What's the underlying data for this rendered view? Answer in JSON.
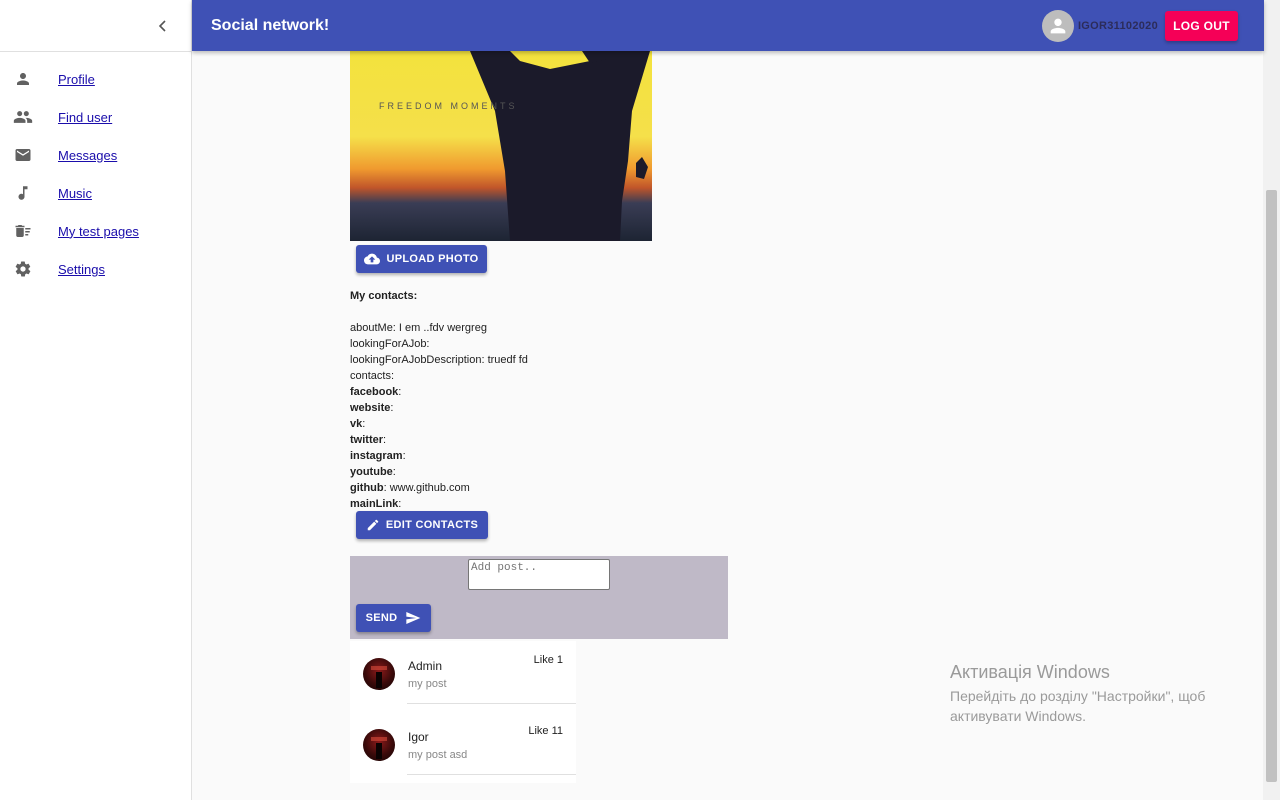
{
  "app": {
    "title": "Social network!"
  },
  "user": {
    "name": "IGOR31102020",
    "logout_label": "LOG OUT"
  },
  "sidebar": {
    "items": [
      {
        "label": "Profile",
        "icon": "person-icon"
      },
      {
        "label": "Find user",
        "icon": "people-icon"
      },
      {
        "label": "Messages",
        "icon": "mail-icon"
      },
      {
        "label": "Music",
        "icon": "music-note-icon"
      },
      {
        "label": "My test pages",
        "icon": "delete-sweep-icon"
      },
      {
        "label": "Settings",
        "icon": "gear-icon"
      }
    ]
  },
  "profile": {
    "photo_caption": "FREEDOM MOMENTS",
    "upload_label": "UPLOAD PHOTO",
    "contacts_title": "My contacts:",
    "about_me": "aboutMe: I em ..fdv wergreg",
    "looking_for_job": "lookingForAJob:",
    "looking_for_job_description": "lookingForAJobDescription: truedf fd",
    "contacts_label": "contacts:",
    "contacts": [
      {
        "key": "facebook",
        "value": ""
      },
      {
        "key": "website",
        "value": ""
      },
      {
        "key": "vk",
        "value": ""
      },
      {
        "key": "twitter",
        "value": ""
      },
      {
        "key": "instagram",
        "value": ""
      },
      {
        "key": "youtube",
        "value": ""
      },
      {
        "key": "github",
        "value": " www.github.com"
      },
      {
        "key": "mainLink",
        "value": ""
      }
    ],
    "edit_label": "EDIT CONTACTS"
  },
  "new_post": {
    "placeholder": "Add post..",
    "send_label": "SEND"
  },
  "posts": [
    {
      "author": "Admin",
      "text": "my post",
      "likes": "Like 1"
    },
    {
      "author": "Igor",
      "text": "my post asd",
      "likes": "Like 11"
    }
  ],
  "windows_activation": {
    "title": "Активація Windows",
    "line1": "Перейдіть до розділу \"Настройки\", щоб",
    "line2": "активувати Windows."
  },
  "colors": {
    "primary": "#3f51b5",
    "accent": "#f50057",
    "post_box": "#bfb9c7"
  }
}
